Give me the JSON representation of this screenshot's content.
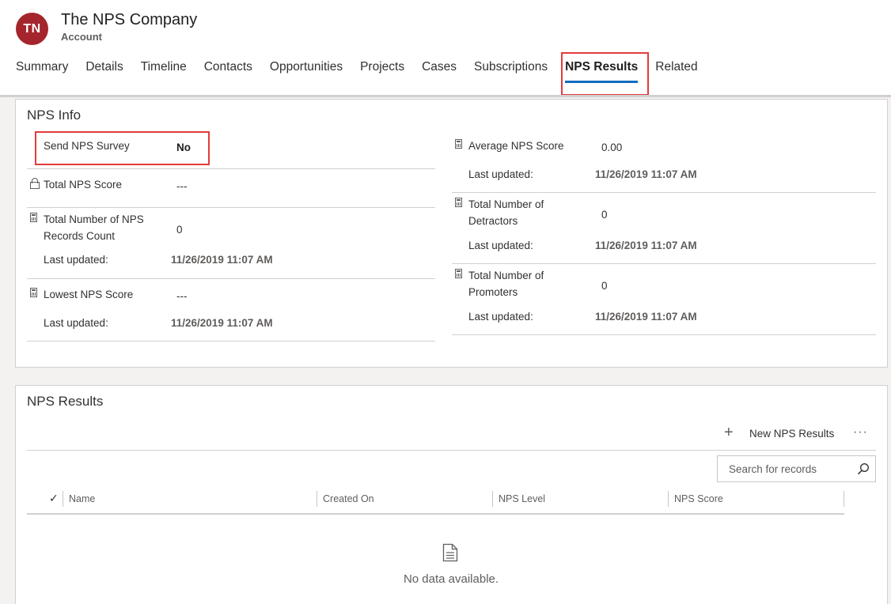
{
  "record": {
    "avatar_initials": "TN",
    "title": "The NPS Company",
    "entity": "Account"
  },
  "tabs": [
    {
      "label": "Summary"
    },
    {
      "label": "Details"
    },
    {
      "label": "Timeline"
    },
    {
      "label": "Contacts"
    },
    {
      "label": "Opportunities"
    },
    {
      "label": "Projects"
    },
    {
      "label": "Cases"
    },
    {
      "label": "Subscriptions"
    },
    {
      "label": "NPS Results",
      "active": true
    },
    {
      "label": "Related"
    }
  ],
  "nps_info": {
    "title": "NPS Info",
    "left": [
      {
        "label": "Send NPS Survey",
        "value": "No"
      },
      {
        "label": "Total NPS Score",
        "value": "---",
        "icon": "lock-icon"
      },
      {
        "label": "Total Number of NPS Records Count",
        "value": "0",
        "icon": "calculator-icon",
        "last_updated_label": "Last updated:",
        "last_updated": "11/26/2019 11:07 AM"
      },
      {
        "label": "Lowest NPS Score",
        "value": "---",
        "icon": "calculator-icon",
        "last_updated_label": "Last updated:",
        "last_updated": "11/26/2019 11:07 AM"
      }
    ],
    "right": [
      {
        "label": "Average NPS Score",
        "value": "0.00",
        "icon": "calculator-icon",
        "last_updated_label": "Last updated:",
        "last_updated": "11/26/2019 11:07 AM"
      },
      {
        "label": "Total Number of Detractors",
        "value": "0",
        "icon": "calculator-icon",
        "last_updated_label": "Last updated:",
        "last_updated": "11/26/2019 11:07 AM"
      },
      {
        "label": "Total Number of Promoters",
        "value": "0",
        "icon": "calculator-icon",
        "last_updated_label": "Last updated:",
        "last_updated": "11/26/2019 11:07 AM"
      }
    ]
  },
  "nps_results": {
    "title": "NPS Results",
    "new_button_label": "New NPS Results",
    "more_label": "···",
    "search_placeholder": "Search for records",
    "columns": [
      "Name",
      "Created On",
      "NPS Level",
      "NPS Score"
    ],
    "empty_text": "No data available."
  },
  "colors": {
    "avatar": "#a4262c",
    "accent": "#0f6cbd",
    "highlight": "#e23b3b"
  }
}
